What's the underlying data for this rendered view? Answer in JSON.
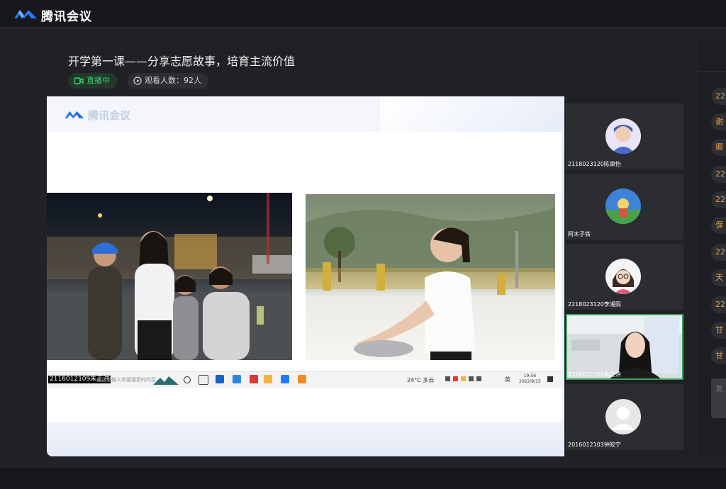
{
  "app": {
    "title": "腾讯会议"
  },
  "meeting": {
    "title": "开学第一课——分享志愿故事，培育主流价值",
    "live_badge": "直播中",
    "viewers_badge": "观看人数：92人"
  },
  "share": {
    "slide_logo_text": "腾讯会议",
    "taskbar": {
      "presenter_label": "2116012109朱正洪",
      "search_text": "在这里输入你要搜索的内容",
      "weather": "24°C  多云",
      "ime": "英",
      "time": "19:56",
      "date": "2022/9/15"
    }
  },
  "participants": [
    {
      "name": "2118023120陈章怡",
      "avatar": "girl-avatar-icon"
    },
    {
      "name": "阿木子铁",
      "avatar": "cartoon-avatar-icon"
    },
    {
      "name": "2218023120李湘雨",
      "avatar": "cartoon-girl-avatar-icon"
    },
    {
      "name": "2116012109朱正洪",
      "avatar": "video-feed",
      "active": true
    },
    {
      "name": "2016012103钟皎宁",
      "avatar": "default-user-icon"
    }
  ],
  "chat": {
    "items": [
      "22",
      "谢",
      "卿",
      "22",
      "22",
      "保",
      "22",
      "天",
      "22",
      "甘",
      "甘"
    ],
    "input_placeholder": "发"
  },
  "colors": {
    "brand": "#0052d9",
    "live": "#3cd170",
    "active_border": "#3aa360",
    "chat_text": "#e3a14a"
  }
}
